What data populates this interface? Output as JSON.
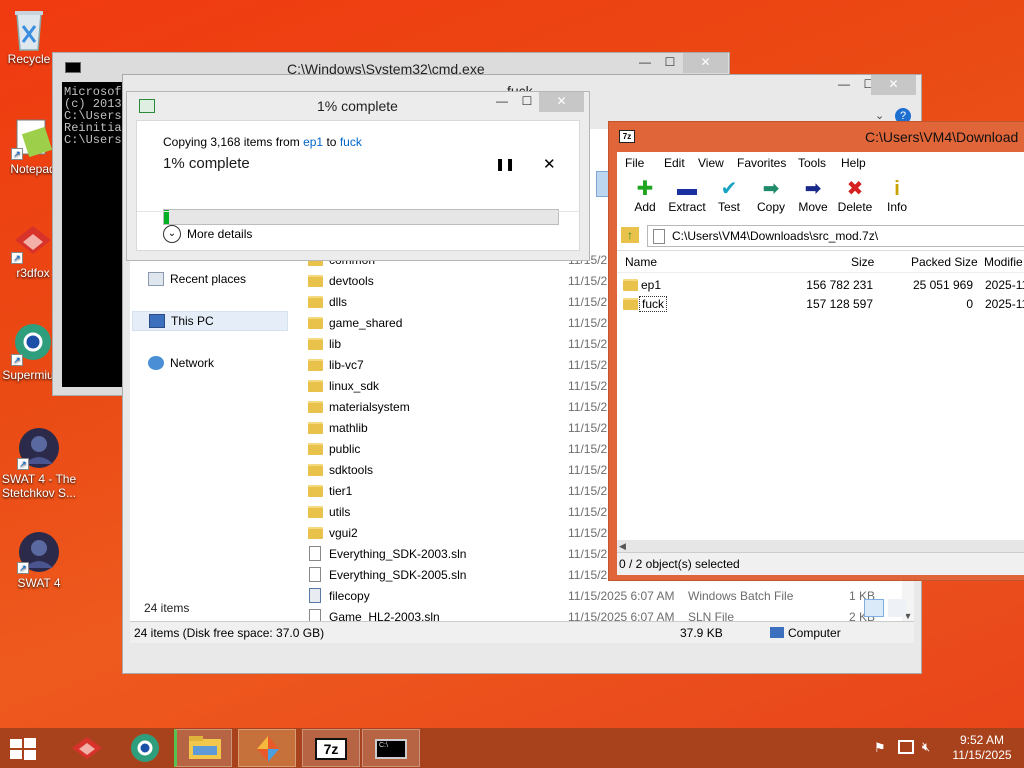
{
  "desktop": {
    "icons": [
      {
        "label": "Recycle"
      },
      {
        "label": "Notepad"
      },
      {
        "label": "r3dfox"
      },
      {
        "label": "Supermium"
      },
      {
        "label": "SWAT 4 - The Stetchkov S..."
      },
      {
        "label": "SWAT 4"
      }
    ]
  },
  "cmd": {
    "title": "C:\\Windows\\System32\\cmd.exe",
    "lines": [
      "Microsof",
      "(c) 2013",
      "",
      "C:\\Users",
      "Reinitia",
      "",
      "C:\\Users"
    ]
  },
  "explorer": {
    "title": "fuck",
    "nav": {
      "recent": "Recent places",
      "thispc": "This PC",
      "network": "Network"
    },
    "rows": [
      {
        "name": "common",
        "date": "11/15/2",
        "kind": "folder"
      },
      {
        "name": "devtools",
        "date": "11/15/2",
        "kind": "folder"
      },
      {
        "name": "dlls",
        "date": "11/15/2",
        "kind": "folder"
      },
      {
        "name": "game_shared",
        "date": "11/15/2",
        "kind": "folder"
      },
      {
        "name": "lib",
        "date": "11/15/2",
        "kind": "folder"
      },
      {
        "name": "lib-vc7",
        "date": "11/15/2",
        "kind": "folder"
      },
      {
        "name": "linux_sdk",
        "date": "11/15/2",
        "kind": "folder"
      },
      {
        "name": "materialsystem",
        "date": "11/15/2",
        "kind": "folder"
      },
      {
        "name": "mathlib",
        "date": "11/15/2",
        "kind": "folder"
      },
      {
        "name": "public",
        "date": "11/15/2",
        "kind": "folder"
      },
      {
        "name": "sdktools",
        "date": "11/15/2",
        "kind": "folder"
      },
      {
        "name": "tier1",
        "date": "11/15/2",
        "kind": "folder"
      },
      {
        "name": "utils",
        "date": "11/15/2",
        "kind": "folder"
      },
      {
        "name": "vgui2",
        "date": "11/15/2",
        "kind": "folder"
      },
      {
        "name": "Everything_SDK-2003.sln",
        "date": "11/15/2",
        "kind": "doc"
      },
      {
        "name": "Everything_SDK-2005.sln",
        "date": "11/15/2",
        "kind": "doc"
      },
      {
        "name": "filecopy",
        "date": "11/15/2025 6:07 AM",
        "type": "Windows Batch File",
        "size": "1 KB",
        "kind": "bat"
      },
      {
        "name": "Game_HL2-2003.sln",
        "date": "11/15/2025 6:07 AM",
        "type": "SLN File",
        "size": "2 KB",
        "kind": "doc"
      }
    ],
    "count": "24 items",
    "status": {
      "left": "24 items (Disk free space: 37.0 GB)",
      "size": "37.9 KB",
      "location": "Computer"
    }
  },
  "copy": {
    "title": "1% complete",
    "from_prefix": "Copying 3,168 items from",
    "from_src": "ep1",
    "to_word": "to",
    "from_dst": "fuck",
    "heading": "1% complete",
    "progress": 0.01,
    "more": "More details"
  },
  "sevenzip": {
    "title": "C:\\Users\\VM4\\Download",
    "menu": [
      "File",
      "Edit",
      "View",
      "Favorites",
      "Tools",
      "Help"
    ],
    "tools": [
      {
        "label": "Add",
        "glyph": "✚",
        "color": "#1fa51f"
      },
      {
        "label": "Extract",
        "glyph": "▬",
        "color": "#1a2fa0"
      },
      {
        "label": "Test",
        "glyph": "✔",
        "color": "#19a3c2"
      },
      {
        "label": "Copy",
        "glyph": "➡",
        "color": "#1e8a6a"
      },
      {
        "label": "Move",
        "glyph": "➡",
        "color": "#1a2a8a"
      },
      {
        "label": "Delete",
        "glyph": "✖",
        "color": "#d42020"
      },
      {
        "label": "Info",
        "glyph": "i",
        "color": "#c9a100"
      }
    ],
    "path": "C:\\Users\\VM4\\Downloads\\src_mod.7z\\",
    "cols": {
      "name": "Name",
      "size": "Size",
      "packed": "Packed Size",
      "modified": "Modifie"
    },
    "rows": [
      {
        "name": "ep1",
        "size": "156 782 231",
        "packed": "25 051 969",
        "modified": "2025-11"
      },
      {
        "name": "fuck",
        "size": "157 128 597",
        "packed": "0",
        "modified": "2025-11"
      }
    ],
    "status": "0 / 2 object(s) selected"
  },
  "taskbar": {
    "time": "9:52 AM",
    "date": "11/15/2025"
  }
}
